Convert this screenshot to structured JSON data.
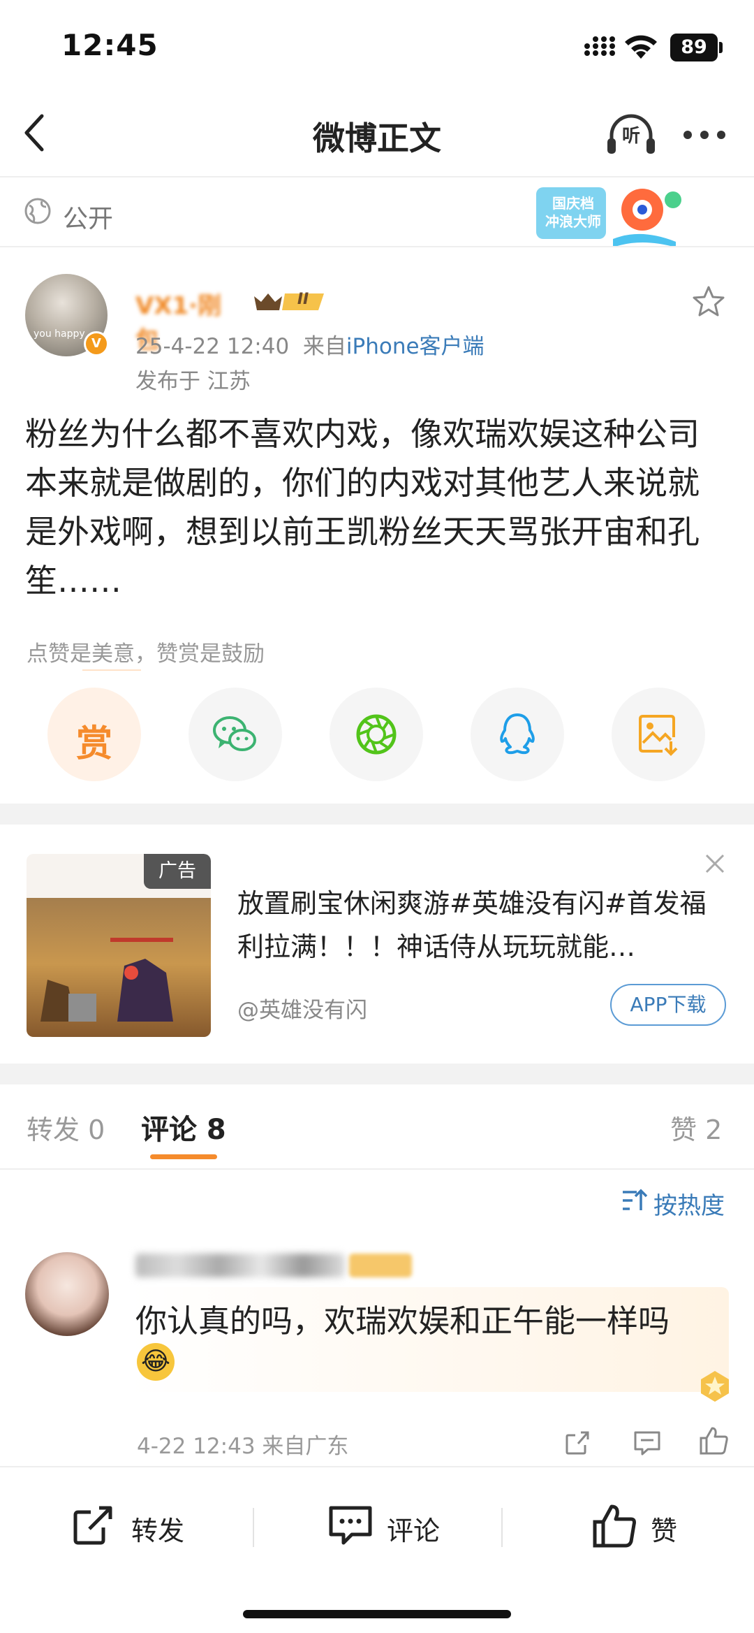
{
  "status_bar": {
    "time": "12:45",
    "battery": "89"
  },
  "nav": {
    "title": "微博正文",
    "listen_label": "听"
  },
  "visibility": {
    "label": "公开",
    "event_badge": [
      "国庆档",
      "冲浪大师"
    ]
  },
  "post": {
    "username": "VX1·刚包",
    "avatar_caption": "you happy",
    "level": "II",
    "timestamp": "25-4-22 12:40",
    "source_prefix": "来自",
    "source": "iPhone客户端",
    "location": "发布于 江苏",
    "text": "粉丝为什么都不喜欢内戏，像欢瑞欢娱这种公司本来就是做剧的，你们的内戏对其他艺人来说就是外戏啊，想到以前王凯粉丝天天骂张开宙和孔笙……"
  },
  "reward": {
    "hint": "点赞是美意，赞赏是鼓励",
    "button_label": "赏"
  },
  "share_icons": [
    "reward-icon",
    "wechat-icon",
    "moments-icon",
    "qq-icon",
    "save-image-icon"
  ],
  "ad": {
    "tag": "广告",
    "text": "放置刷宝休闲爽游#英雄没有闪#首发福利拉满！！！神话侍从玩玩就能…",
    "source": "@英雄没有闪",
    "download_label": "APP下载"
  },
  "tabs": {
    "repost": "转发 0",
    "comments": "评论 8",
    "likes": "赞 2"
  },
  "sort": {
    "label": "按热度"
  },
  "comment": {
    "text": "你认真的吗，欢瑞欢娱和正午能一样吗",
    "emoji": "😂",
    "meta": "4-22 12:43 来自广东"
  },
  "bottom_bar": {
    "repost": "转发",
    "comment": "评论",
    "like": "赞"
  },
  "colors": {
    "accent": "#f58b2c",
    "link": "#3a7bb8",
    "wechat": "#3cb371",
    "moments": "#52c41a",
    "qq": "#1e9ee8",
    "save": "#f5a623"
  }
}
